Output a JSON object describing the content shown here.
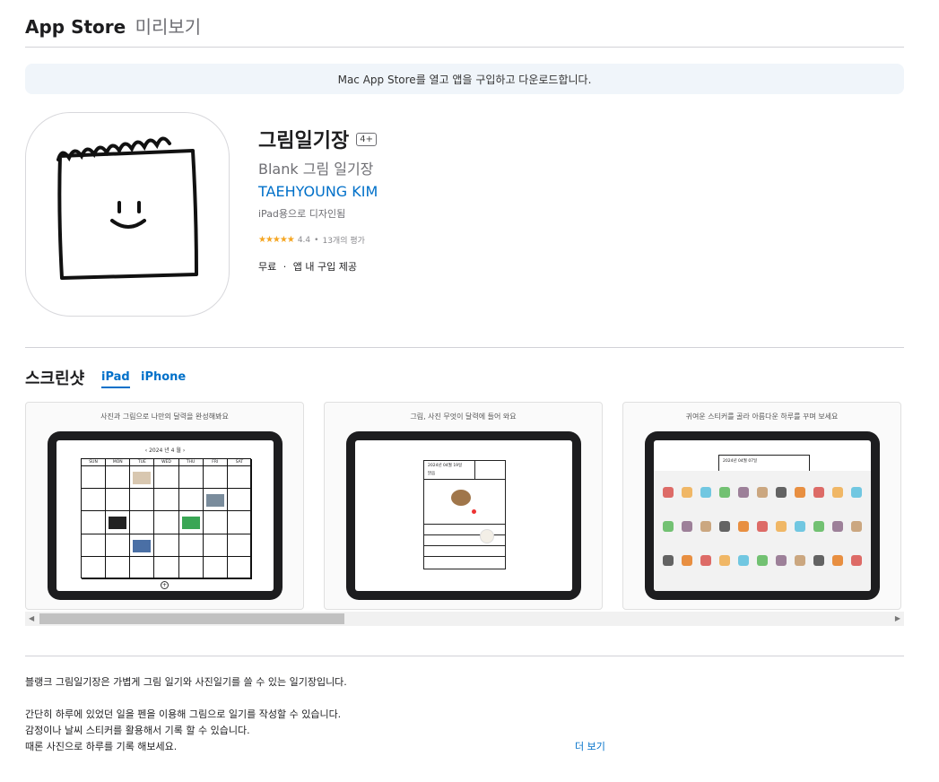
{
  "header": {
    "brand": "App Store",
    "sub": "미리보기"
  },
  "banner": {
    "text": "Mac App Store를 열고 앱을 구입하고 다운로드합니다."
  },
  "app": {
    "title": "그림일기장",
    "age_rating": "4+",
    "subtitle": "Blank 그림 일기장",
    "developer": "TAEHYOUNG KIM",
    "designed_for": "iPad용으로 디자인됨",
    "rating_value": "4.4",
    "rating_count": "13개의 평가",
    "stars": "★★★★★",
    "price": "무료",
    "iap": "앱 내 구입 제공",
    "price_separator": "·"
  },
  "screenshots": {
    "title": "스크린샷",
    "tabs": [
      {
        "label": "iPad",
        "active": true
      },
      {
        "label": "iPhone",
        "active": false
      }
    ],
    "items": [
      {
        "caption": "사진과 그림으로 나만의 달력을 완성해봐요"
      },
      {
        "caption": "그림, 사진 무엇이 달력에 들어 와요"
      },
      {
        "caption": "귀여운 스티커를 골라 아름다운 하루를 꾸며 보세요"
      }
    ],
    "calendar": {
      "month_label": "‹ 2024 년 4 월 ›",
      "weekdays": [
        "SUN",
        "MON",
        "TUE",
        "WED",
        "THU",
        "FRI",
        "SAT"
      ]
    },
    "diary": {
      "date": "2024년 04월 19일",
      "weather": "맑음",
      "stickers_header": "2024년 04월 07일"
    }
  },
  "description": {
    "lines": [
      "블랭크 그림일기장은 가볍게 그림 일기와 사진일기를 쓸 수 있는 일기장입니다.",
      "간단히 하루에 있었던 일을 펜을 이용해 그림으로 일기를 작성할 수 있습니다.",
      "감정이나 날씨 스티커를 활용해서 기록 할 수 있습니다.",
      "때론 사진으로 하루를 기록 해보세요."
    ],
    "more": "더 보기"
  },
  "colors": {
    "accent": "#0070c9",
    "star": "#f5a623",
    "banner_bg": "#f0f5fa"
  }
}
